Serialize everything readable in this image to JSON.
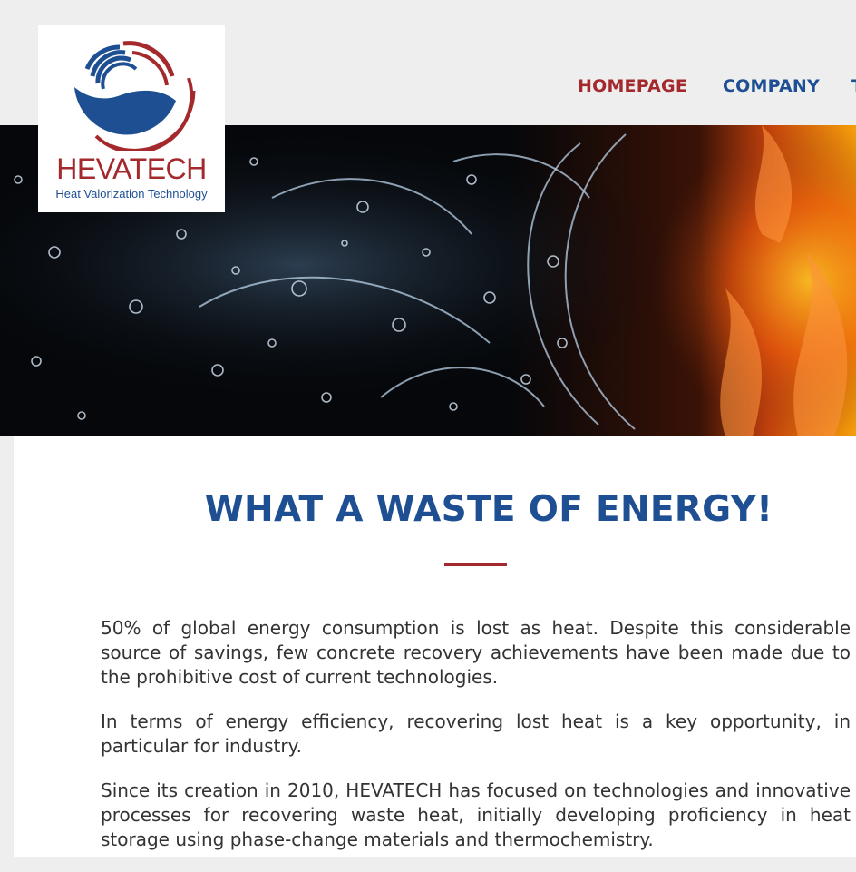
{
  "header": {
    "logo": {
      "name": "HEVATECH",
      "tagline": "Heat Valorization Technology"
    },
    "nav": {
      "items": [
        "HOMEPAGE",
        "COMPANY",
        "T"
      ],
      "active": "HOMEPAGE"
    }
  },
  "hero": {
    "image": "water-and-fire-splash"
  },
  "main": {
    "title": "WHAT A WASTE OF ENERGY!",
    "paragraphs": [
      "50% of global energy consumption is lost as heat. Despite this considerable source of savings, few concrete recovery achievements have been made due to the prohibitive cost of current technologies.",
      "In terms of energy efficiency, recovering lost heat is a key opportunity, in particular for industry.",
      "Since its creation in 2010, HEVATECH has focused on technologies and innovative processes for recovering waste heat, initially developing proficiency in heat storage using phase-change materials and thermochemistry."
    ]
  },
  "colors": {
    "brand_red": "#a3292c",
    "brand_blue": "#1f4f93",
    "page_bg": "#eeeeee"
  }
}
